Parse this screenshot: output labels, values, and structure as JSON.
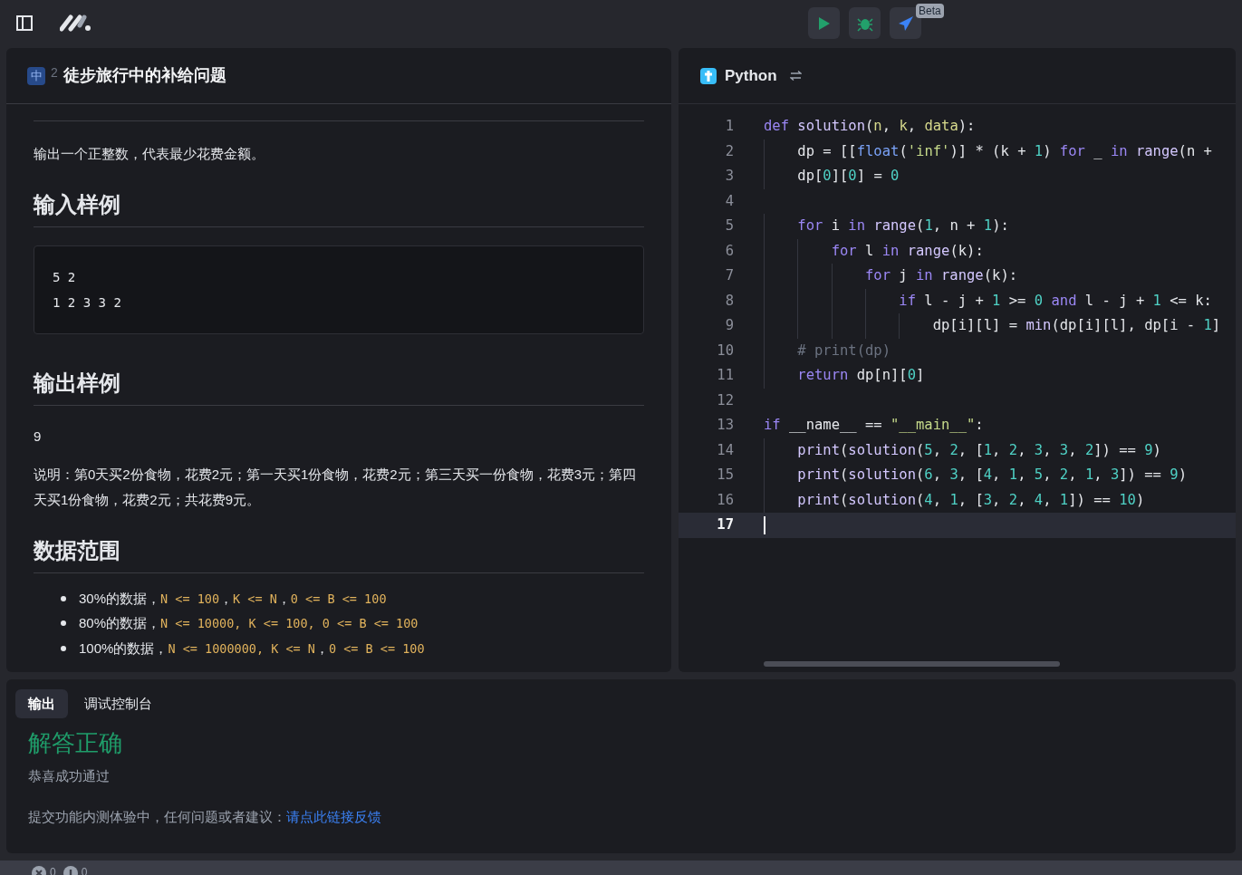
{
  "toolbar": {
    "buttons": [
      {
        "kind": "run"
      },
      {
        "kind": "debug"
      },
      {
        "kind": "submit",
        "badge": "Beta"
      }
    ]
  },
  "problem": {
    "difficulty": "中",
    "number": "2",
    "title": "徒步旅行中的补给问题",
    "blocks": [
      {
        "kind": "text",
        "text": "输出一个正整数，代表最少花费金额。"
      },
      {
        "kind": "heading",
        "text": "输入样例"
      },
      {
        "kind": "code",
        "lines": [
          "5 2",
          "1 2 3 3 2"
        ]
      },
      {
        "kind": "heading",
        "text": "输出样例"
      },
      {
        "kind": "text",
        "text": "9"
      },
      {
        "kind": "text",
        "text": "说明：第0天买2份食物，花费2元；第一天买1份食物，花费2元；第三天买一份食物，花费3元；第四天买1份食物，花费2元；共花费9元。"
      },
      {
        "kind": "heading",
        "text": "数据范围"
      },
      {
        "kind": "list",
        "items": [
          [
            {
              "t": "30%的数据，",
              "kind": "text"
            },
            {
              "t": "N <= 100",
              "kind": "code"
            },
            {
              "t": "，",
              "kind": "text"
            },
            {
              "t": "K <= N",
              "kind": "code"
            },
            {
              "t": "，",
              "kind": "text"
            },
            {
              "t": "0 <= B <= 100",
              "kind": "code"
            }
          ],
          [
            {
              "t": "80%的数据，",
              "kind": "text"
            },
            {
              "t": "N <= 10000, K <= 100, 0 <= B <= 100",
              "kind": "code"
            }
          ],
          [
            {
              "t": "100%的数据，",
              "kind": "text"
            },
            {
              "t": "N <= 1000000, K <= N",
              "kind": "code"
            },
            {
              "t": "，",
              "kind": "text"
            },
            {
              "t": "0 <= B <= 100",
              "kind": "code"
            }
          ]
        ]
      }
    ]
  },
  "editor": {
    "language": "Python",
    "lines": [
      {
        "n": "1",
        "active": false,
        "text": "def solution(n, k, data):"
      },
      {
        "n": "2",
        "active": false,
        "text": "    dp = [[float('inf')] * (k + 1) for _ in range(n +"
      },
      {
        "n": "3",
        "active": false,
        "text": "    dp[0][0] = 0"
      },
      {
        "n": "4",
        "active": false
      },
      {
        "n": "5",
        "active": false,
        "text": "    for i in range(1, n + 1):"
      },
      {
        "n": "6",
        "active": false,
        "text": "        for l in range(k):"
      },
      {
        "n": "7",
        "active": false,
        "text": "            for j in range(k):"
      },
      {
        "n": "8",
        "active": false,
        "text": "                if l - j + 1 >= 0 and l - j + 1 <= k:"
      },
      {
        "n": "9",
        "active": false,
        "text": "                    dp[i][l] = min(dp[i][l], dp[i - 1]"
      },
      {
        "n": "10",
        "active": false,
        "text": "    # print(dp)"
      },
      {
        "n": "11",
        "active": false,
        "text": "    return dp[n][0]"
      },
      {
        "n": "12",
        "active": false
      },
      {
        "n": "13",
        "active": false,
        "text": "if __name__ == \"__main__\":"
      },
      {
        "n": "14",
        "active": false,
        "text": "    print(solution(5, 2, [1, 2, 3, 3, 2]) == 9)"
      },
      {
        "n": "15",
        "active": false,
        "text": "    print(solution(6, 3, [4, 1, 5, 2, 1, 3]) == 9)"
      },
      {
        "n": "16",
        "active": false,
        "text": "    print(solution(4, 1, [3, 2, 4, 1]) == 10)"
      },
      {
        "n": "17",
        "active": true
      }
    ]
  },
  "output": {
    "tabs": [
      {
        "label": "输出",
        "selected": true
      },
      {
        "label": "调试控制台",
        "selected": false
      }
    ],
    "verdict": "解答正确",
    "message": "恭喜成功通过",
    "note": "提交功能内测体验中，任何问题或者建议：",
    "link": "请点此链接反馈"
  },
  "status_bar": {
    "errors": "0",
    "warnings": "0"
  }
}
